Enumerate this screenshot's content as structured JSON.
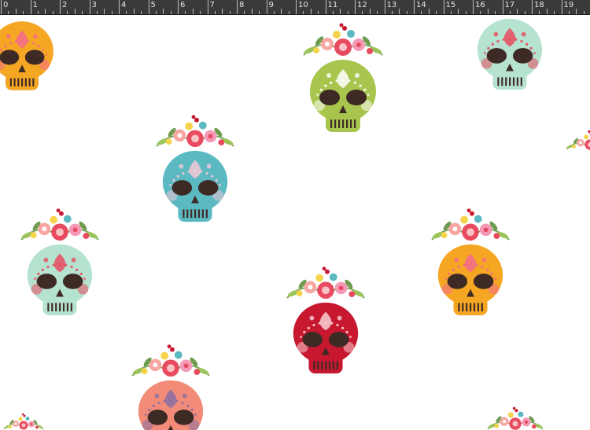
{
  "ruler": {
    "unit": "inch",
    "labels": [
      "0",
      "1",
      "2",
      "3",
      "4",
      "5",
      "6",
      "7",
      "8",
      "9",
      "10",
      "11",
      "12",
      "13",
      "14",
      "15",
      "16",
      "17",
      "18",
      "19"
    ]
  },
  "pattern": {
    "name": "sugar-skull-pattern",
    "background": "#ffffff",
    "skulls": [
      {
        "id": "orange-top-left",
        "color": "#f5a623",
        "accent": "#f26b8a",
        "flowers": false
      },
      {
        "id": "green-top-center",
        "color": "#a8c64e",
        "accent": "#ffffff",
        "flowers": true
      },
      {
        "id": "mint-top-right",
        "color": "#b5e3d0",
        "accent": "#e84a5f",
        "flowers": false
      },
      {
        "id": "teal-center-left",
        "color": "#5bb9c2",
        "accent": "#f6c9d8",
        "flowers": true
      },
      {
        "id": "mint-left",
        "color": "#b5e3d0",
        "accent": "#e84a5f",
        "flowers": true
      },
      {
        "id": "orange-right",
        "color": "#f5a623",
        "accent": "#f26b8a",
        "flowers": true
      },
      {
        "id": "red-center",
        "color": "#c7182f",
        "accent": "#f8d0d4",
        "flowers": true
      },
      {
        "id": "salmon-bottom",
        "color": "#f28b78",
        "accent": "#8a6fa3",
        "flowers": true
      }
    ]
  }
}
